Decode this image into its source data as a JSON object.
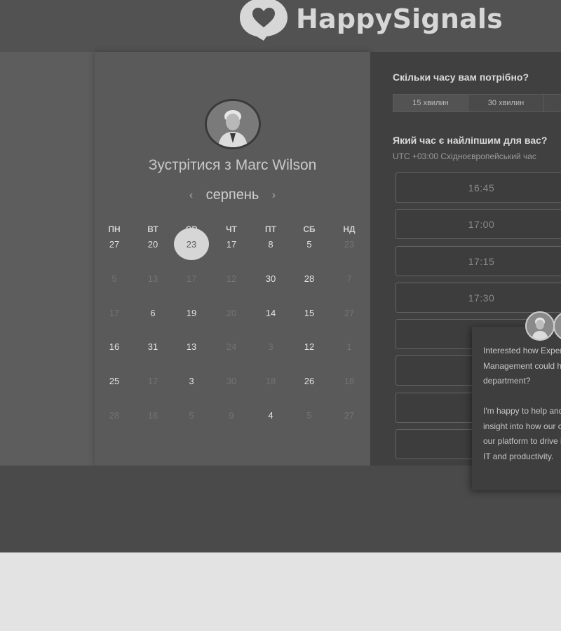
{
  "brand": {
    "name": "HappySignals"
  },
  "calendar": {
    "title_prefix": "Зустрітися з",
    "host_name": "Marc Wilson",
    "month": "серпень",
    "prev_icon": "‹",
    "next_icon": "›",
    "weekdays": [
      "ПН",
      "ВТ",
      "СР",
      "ЧТ",
      "ПТ",
      "СБ",
      "НД"
    ],
    "weeks": [
      [
        {
          "d": "27",
          "dim": false
        },
        {
          "d": "20",
          "dim": false
        },
        {
          "d": "23",
          "dim": false,
          "selected": true
        },
        {
          "d": "17",
          "dim": false
        },
        {
          "d": "8",
          "dim": false
        },
        {
          "d": "5",
          "dim": false
        },
        {
          "d": "23",
          "dim": true
        }
      ],
      [
        {
          "d": "5",
          "dim": true
        },
        {
          "d": "13",
          "dim": true
        },
        {
          "d": "17",
          "dim": true
        },
        {
          "d": "12",
          "dim": true
        },
        {
          "d": "30",
          "dim": false
        },
        {
          "d": "28",
          "dim": false
        },
        {
          "d": "7",
          "dim": true
        }
      ],
      [
        {
          "d": "17",
          "dim": true
        },
        {
          "d": "6",
          "dim": false
        },
        {
          "d": "19",
          "dim": false
        },
        {
          "d": "20",
          "dim": true
        },
        {
          "d": "14",
          "dim": false
        },
        {
          "d": "15",
          "dim": false
        },
        {
          "d": "27",
          "dim": true
        }
      ],
      [
        {
          "d": "16",
          "dim": false
        },
        {
          "d": "31",
          "dim": false
        },
        {
          "d": "13",
          "dim": false
        },
        {
          "d": "24",
          "dim": true
        },
        {
          "d": "3",
          "dim": true
        },
        {
          "d": "12",
          "dim": false
        },
        {
          "d": "1",
          "dim": true
        }
      ],
      [
        {
          "d": "25",
          "dim": false
        },
        {
          "d": "17",
          "dim": true
        },
        {
          "d": "3",
          "dim": false
        },
        {
          "d": "30",
          "dim": true
        },
        {
          "d": "18",
          "dim": true
        },
        {
          "d": "26",
          "dim": false
        },
        {
          "d": "18",
          "dim": true
        }
      ],
      [
        {
          "d": "28",
          "dim": true
        },
        {
          "d": "16",
          "dim": true
        },
        {
          "d": "5",
          "dim": true
        },
        {
          "d": "9",
          "dim": true
        },
        {
          "d": "4",
          "dim": false
        },
        {
          "d": "5",
          "dim": true
        },
        {
          "d": "27",
          "dim": true
        }
      ]
    ]
  },
  "booking": {
    "duration_question": "Скільки часу вам потрібно?",
    "durations": [
      "15 хвилин",
      "30 хвилин"
    ],
    "time_question": "Який час є найліпшим для вас?",
    "timezone": "UTC +03:00 Східноєвропейський час",
    "slots": [
      "16:45",
      "17:00",
      "17:15",
      "17:30",
      "",
      "",
      ""
    ]
  },
  "chat": {
    "message": "Interested how Experience Management could help your department?\n\nI'm happy to help and give you insight into how our customers use our platform to drive improvement in IT and productivity."
  }
}
